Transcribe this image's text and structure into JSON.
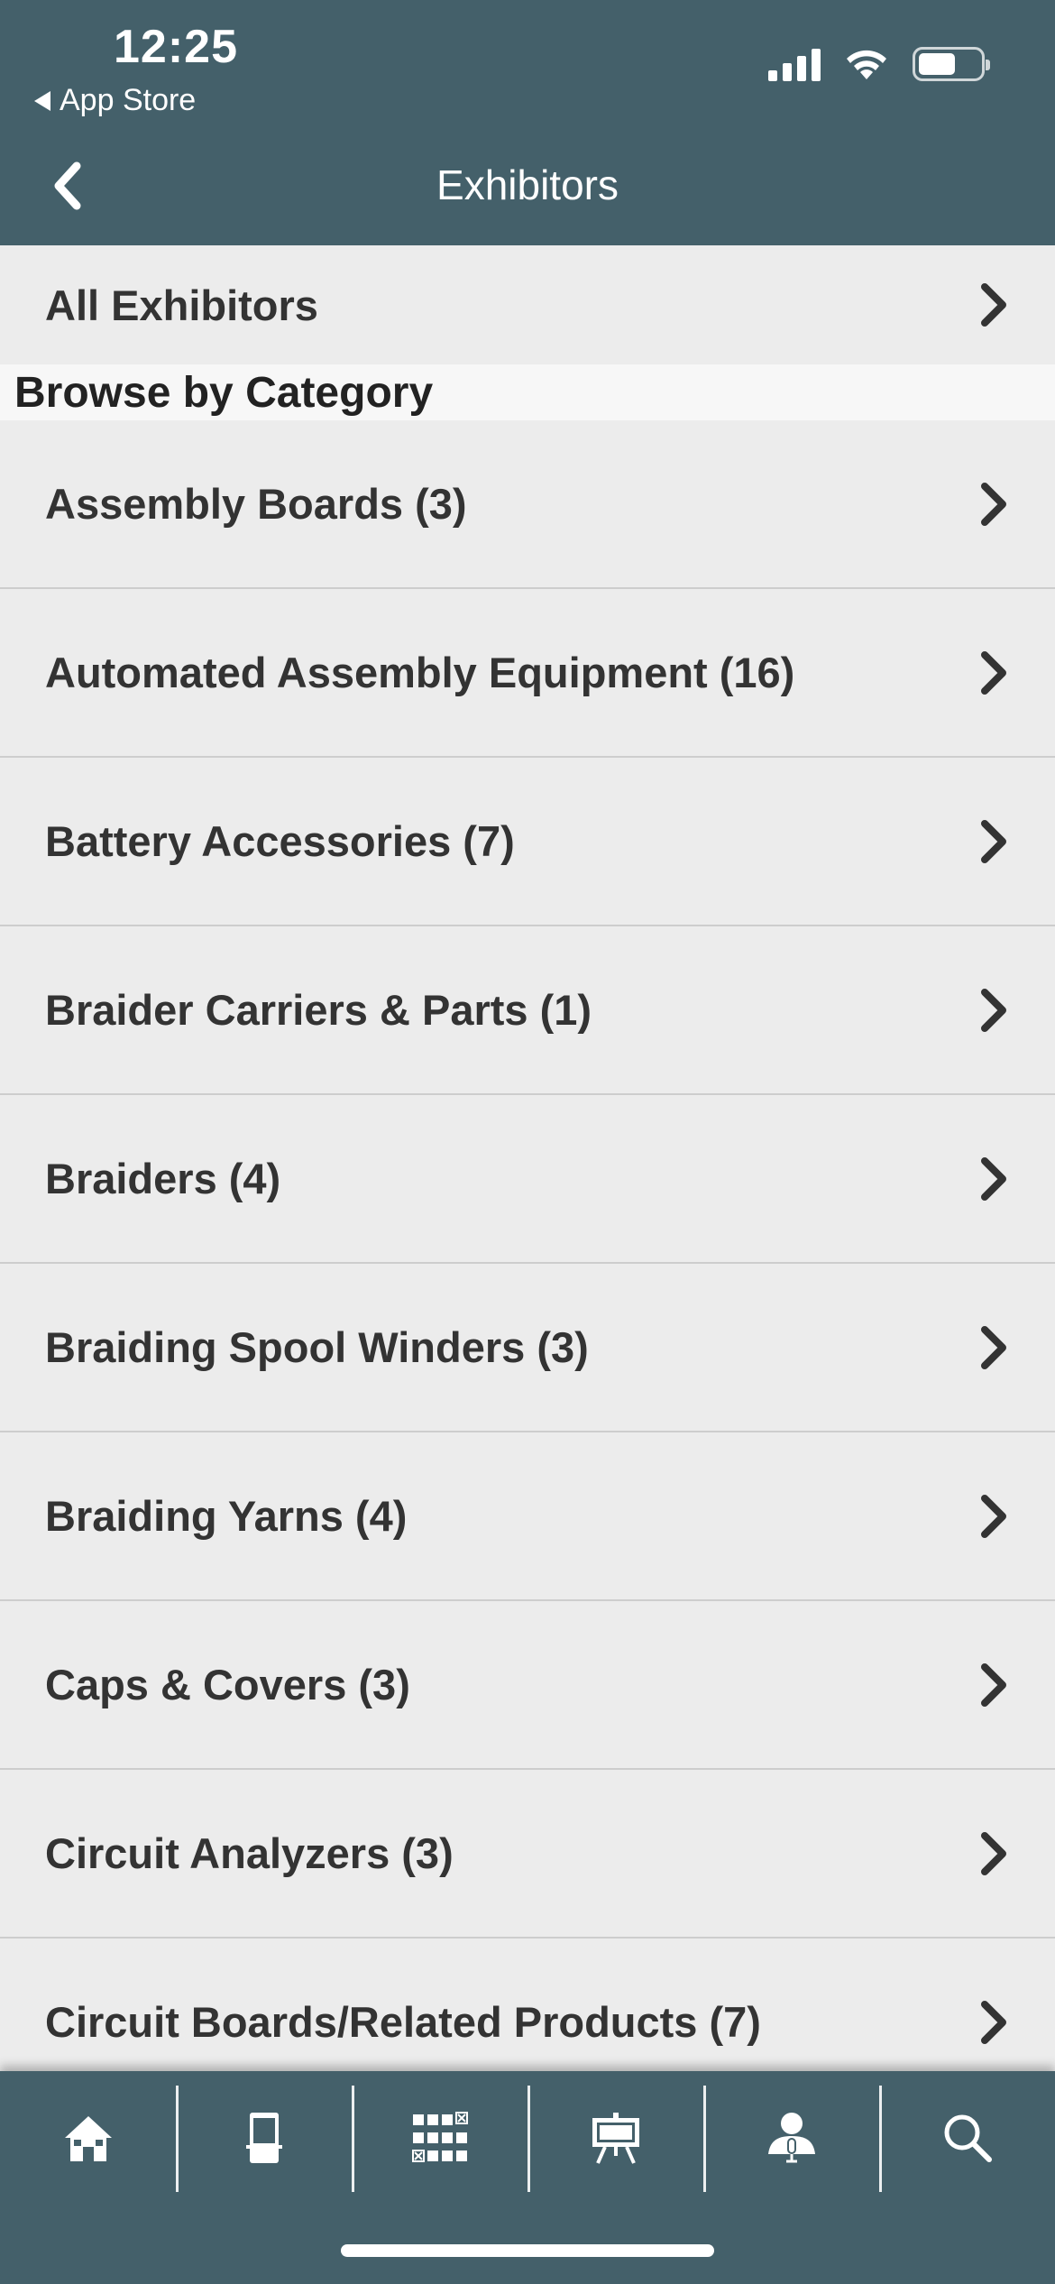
{
  "status_bar": {
    "time": "12:25",
    "back_app": "App Store"
  },
  "header": {
    "title": "Exhibitors"
  },
  "all_exhibitors": {
    "label": "All Exhibitors"
  },
  "section": {
    "title": "Browse by Category"
  },
  "categories": [
    {
      "label": "Assembly Boards (3)"
    },
    {
      "label": "Automated Assembly Equipment (16)"
    },
    {
      "label": "Battery Accessories (7)"
    },
    {
      "label": "Braider Carriers & Parts (1)"
    },
    {
      "label": "Braiders (4)"
    },
    {
      "label": "Braiding Spool Winders (3)"
    },
    {
      "label": "Braiding Yarns (4)"
    },
    {
      "label": "Caps & Covers (3)"
    },
    {
      "label": "Circuit Analyzers (3)"
    },
    {
      "label": "Circuit Boards/Related Products (7)"
    }
  ],
  "tabbar": {
    "items": [
      {
        "icon": "home-icon"
      },
      {
        "icon": "booth-icon"
      },
      {
        "icon": "floorplan-icon"
      },
      {
        "icon": "presentation-icon"
      },
      {
        "icon": "speaker-icon"
      },
      {
        "icon": "search-icon"
      }
    ]
  },
  "colors": {
    "header_bg": "#44606a",
    "row_bg": "#ececec",
    "separator": "#cdcdcd"
  }
}
